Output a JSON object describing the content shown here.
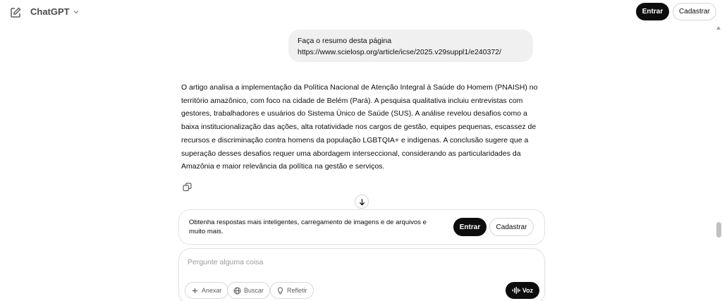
{
  "header": {
    "brand": "ChatGPT",
    "login_label": "Entrar",
    "signup_label": "Cadastrar"
  },
  "conversation": {
    "user_message": {
      "line1": "Faça o resumo desta página",
      "line2": "https://www.scielosp.org/article/icse/2025.v29suppl1/e240372/"
    },
    "assistant_message": "O artigo analisa a implementação da Política Nacional de Atenção Integral à Saúde do Homem (PNAISH) no território amazônico, com foco na cidade de Belém (Pará). A pesquisa qualitativa incluiu entrevistas com gestores, trabalhadores e usuários do Sistema Único de Saúde (SUS). A análise revelou desafios como a baixa institucionalização das ações, alta rotatividade nos cargos de gestão, equipes pequenas, escassez de recursos e discriminação contra homens da população LGBTQIA+ e indígenas. A conclusão sugere que a superação desses desafios requer uma abordagem interseccional, considerando as particularidades da Amazônia e maior relevância da política na gestão e serviços."
  },
  "promo": {
    "text": "Obtenha respostas mais inteligentes, carregamento de imagens e de arquivos e muito mais.",
    "login_label": "Entrar",
    "signup_label": "Cadastrar"
  },
  "composer": {
    "placeholder": "Pergunte alguma coisa",
    "attach_label": "Anexar",
    "search_label": "Buscar",
    "think_label": "Refletir",
    "voice_label": "Voz"
  },
  "icons": {
    "new_chat": "edit-icon",
    "brand_menu": "chevron-down-icon",
    "copy": "copy-icon",
    "scroll_down": "arrow-down-icon",
    "attach": "plus-icon",
    "search": "globe-icon",
    "think": "lightbulb-icon",
    "voice": "waveform-icon"
  },
  "colors": {
    "primary_button": "#0d0d0d",
    "bubble": "#f0f0f0",
    "text": "#0d0d0d"
  }
}
